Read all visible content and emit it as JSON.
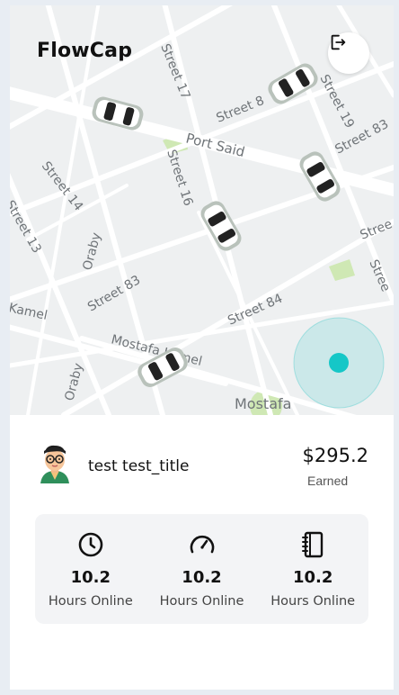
{
  "app": {
    "brand": "FlowCap"
  },
  "header": {
    "logout_icon": "logout-icon"
  },
  "map": {
    "streets": [
      "Street 17",
      "Street 8",
      "Street 19",
      "Street 83",
      "Port Said",
      "Street 14",
      "Street 16",
      "Street 13",
      "Oraby",
      "Street 83",
      "Street 84",
      "Stree",
      "Stree",
      "Kamel",
      "Mostafa Kamel",
      "Oraby",
      "Mostafa"
    ],
    "location_color": "#18c1c1"
  },
  "driver": {
    "name": "test test_title",
    "earned_amount": "$295.2",
    "earned_label": "Earned"
  },
  "stats": [
    {
      "icon": "clock-icon",
      "value": "10.2",
      "label": "Hours Online"
    },
    {
      "icon": "speedometer-icon",
      "value": "10.2",
      "label": "Hours Online"
    },
    {
      "icon": "notebook-icon",
      "value": "10.2",
      "label": "Hours Online"
    }
  ]
}
